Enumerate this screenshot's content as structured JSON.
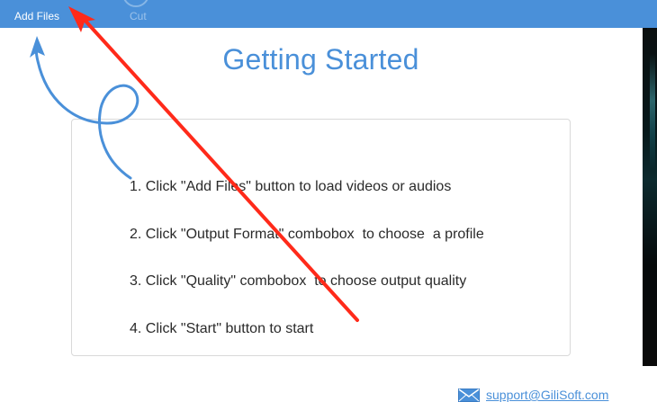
{
  "toolbar": {
    "add_files_label": "Add Files",
    "cut_label": "Cut"
  },
  "main": {
    "title": "Getting Started",
    "steps": [
      "1. Click \"Add Files\" button to load videos or audios",
      "2. Click \"Output Format\" combobox  to choose  a profile",
      "3. Click \"Quality\" combobox  to choose output quality",
      "4. Click \"Start\" button to start"
    ]
  },
  "footer": {
    "support_email": "support@GiliSoft.com",
    "mail_icon": "mail-icon"
  },
  "colors": {
    "toolbar": "#4a90d9",
    "accent": "#4a90d9",
    "annotation_arrow": "#ff2a1a",
    "hint_arrow": "#4a90d9"
  }
}
